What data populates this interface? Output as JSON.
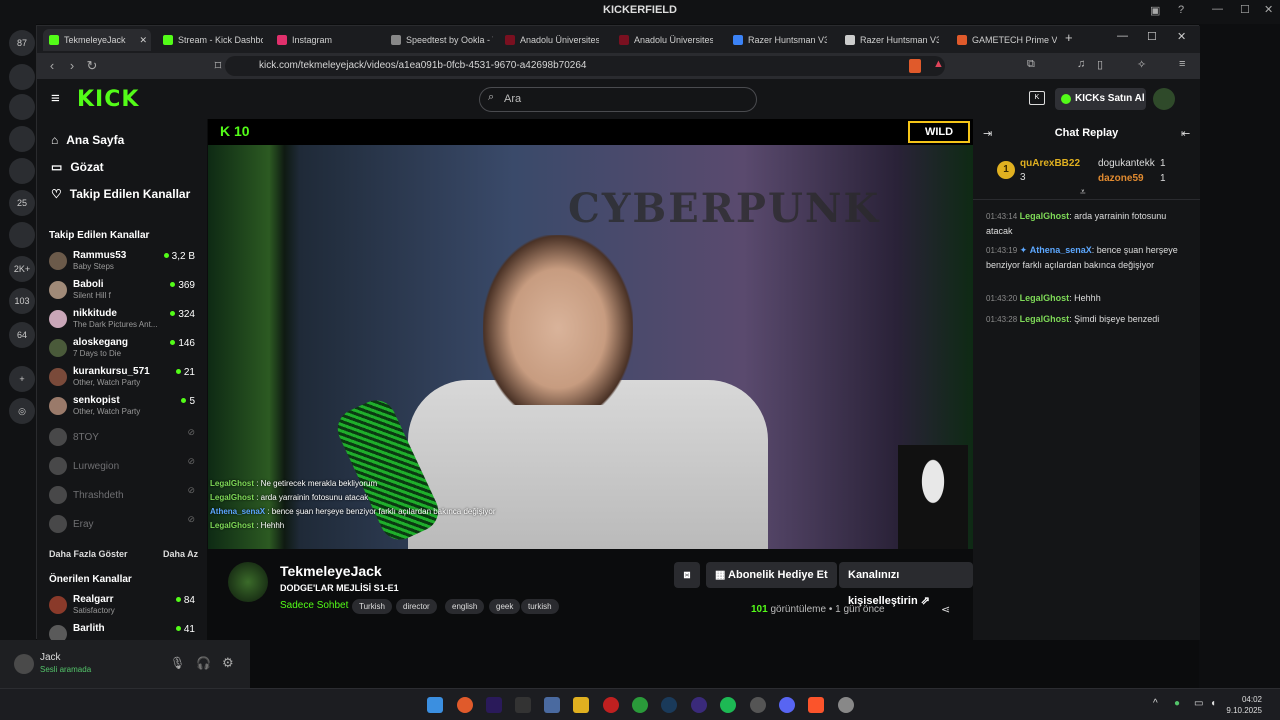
{
  "outer": {
    "title": "KICKERFIELD",
    "user": "Jack",
    "user_status": "Sesli aramada",
    "server_badges": [
      "87",
      "25",
      "2K+",
      "103",
      "64"
    ]
  },
  "tabs": [
    {
      "label": "TekmeleyeJack",
      "color": "#53fc18"
    },
    {
      "label": "Stream - Kick Dashboa",
      "color": "#53fc18"
    },
    {
      "label": "Instagram",
      "color": "#e1306c"
    },
    {
      "label": "Speedtest by Ookla - T",
      "color": "#888888"
    },
    {
      "label": "Anadolu Üniversitesi A",
      "color": "#7a1020"
    },
    {
      "label": "Anadolu Üniversitesi A",
      "color": "#7a1020"
    },
    {
      "label": "Razer Huntsman V3 P",
      "color": "#3b82f6"
    },
    {
      "label": "Razer Huntsman V3 P",
      "color": "#cccccc"
    },
    {
      "label": "GAMETECH Prime V2",
      "color": "#e05a2b"
    }
  ],
  "address": {
    "url": "kick.com/tekmeleyejack/videos/a1ea091b-0fcb-4531-9670-a42698b70264"
  },
  "header": {
    "logo": "KICK",
    "search_placeholder": "Ara",
    "kicks_button": "KICKs Satın Al"
  },
  "sidebar": {
    "nav": [
      "Ana Sayfa",
      "Gözat",
      "Takip Edilen Kanallar"
    ],
    "followed_title": "Takip Edilen Kanallar",
    "followed": [
      {
        "name": "Rammus53",
        "sub": "Baby Steps",
        "viewers": "3,2 B",
        "color": "#6b5a4a"
      },
      {
        "name": "Baboli",
        "sub": "Silent Hill f",
        "viewers": "369",
        "color": "#a08a78"
      },
      {
        "name": "nikkitude",
        "sub": "The Dark Pictures Ant...",
        "viewers": "324",
        "color": "#c9a6b8"
      },
      {
        "name": "aloskegang",
        "sub": "7 Days to Die",
        "viewers": "146",
        "color": "#4a5a3a"
      },
      {
        "name": "kurankursu_571",
        "sub": "Other, Watch Party",
        "viewers": "21",
        "color": "#7a4a3a"
      },
      {
        "name": "senkopist",
        "sub": "Other, Watch Party",
        "viewers": "5",
        "color": "#9a7a6a"
      }
    ],
    "offline": [
      "8TOY",
      "Lurwegion",
      "Thrashdeth",
      "Eray"
    ],
    "show_more": "Daha Fazla Göster",
    "show_less": "Daha Az",
    "recommended_title": "Önerilen Kanallar",
    "recommended": [
      {
        "name": "Realgarr",
        "sub": "Satisfactory",
        "viewers": "84",
        "color": "#8a3a2a"
      },
      {
        "name": "Barlith",
        "sub": "",
        "viewers": "41",
        "color": "#5a5a5a"
      }
    ]
  },
  "video": {
    "counter": "10",
    "natgeo": "WILD",
    "overlay_chat": [
      {
        "user": "LegalGhost",
        "text": " : Ne getirecek merakla bekliyorum"
      },
      {
        "user": "LegalGhost",
        "text": " : arda yarrainin fotosunu atacak"
      },
      {
        "user": "Athena_senaX",
        "text": " : bence şuan herşeye benziyor farklı açılardan bakınca değişiyor"
      },
      {
        "user": "LegalGhost",
        "text": " : Hehhh"
      }
    ],
    "bg_text": "CYBERPUNK"
  },
  "info": {
    "streamer": "TekmeleyeJack",
    "title": "DODGE'LAR MEJLİSİ S1-E1",
    "category": "Sadece Sohbet",
    "tags": [
      "Turkish",
      "director",
      "english",
      "geek",
      "turkish"
    ],
    "gift_button": "Abonelik Hediye Et",
    "customize_button": "Kanalınızı kişiselleştirin",
    "views_count": "101",
    "views_label": "görüntüleme",
    "time_ago": "1 gün önce"
  },
  "chat": {
    "title": "Chat Replay",
    "leaderboard": [
      {
        "name": "quArexBB22",
        "count": "3"
      },
      {
        "name": "dogukantekk",
        "count": "1"
      },
      {
        "name": "dazone59",
        "count": "1"
      }
    ],
    "messages": [
      {
        "time": "01:43:14",
        "user": "LegalGhost",
        "text": ": arda yarrainin fotosunu atacak"
      },
      {
        "time": "01:43:19",
        "user": "Athena_senaX",
        "text": ": bence şuan herşeye benziyor farklı açılardan bakınca değişiyor"
      },
      {
        "time": "01:43:20",
        "user": "LegalGhost",
        "text": ": Hehhh"
      },
      {
        "time": "01:43:28",
        "user": "LegalGhost",
        "text": ": Şimdi bişeye benzedi"
      }
    ]
  },
  "taskbar": {
    "time": "04:02",
    "date": "9.10.2025"
  }
}
